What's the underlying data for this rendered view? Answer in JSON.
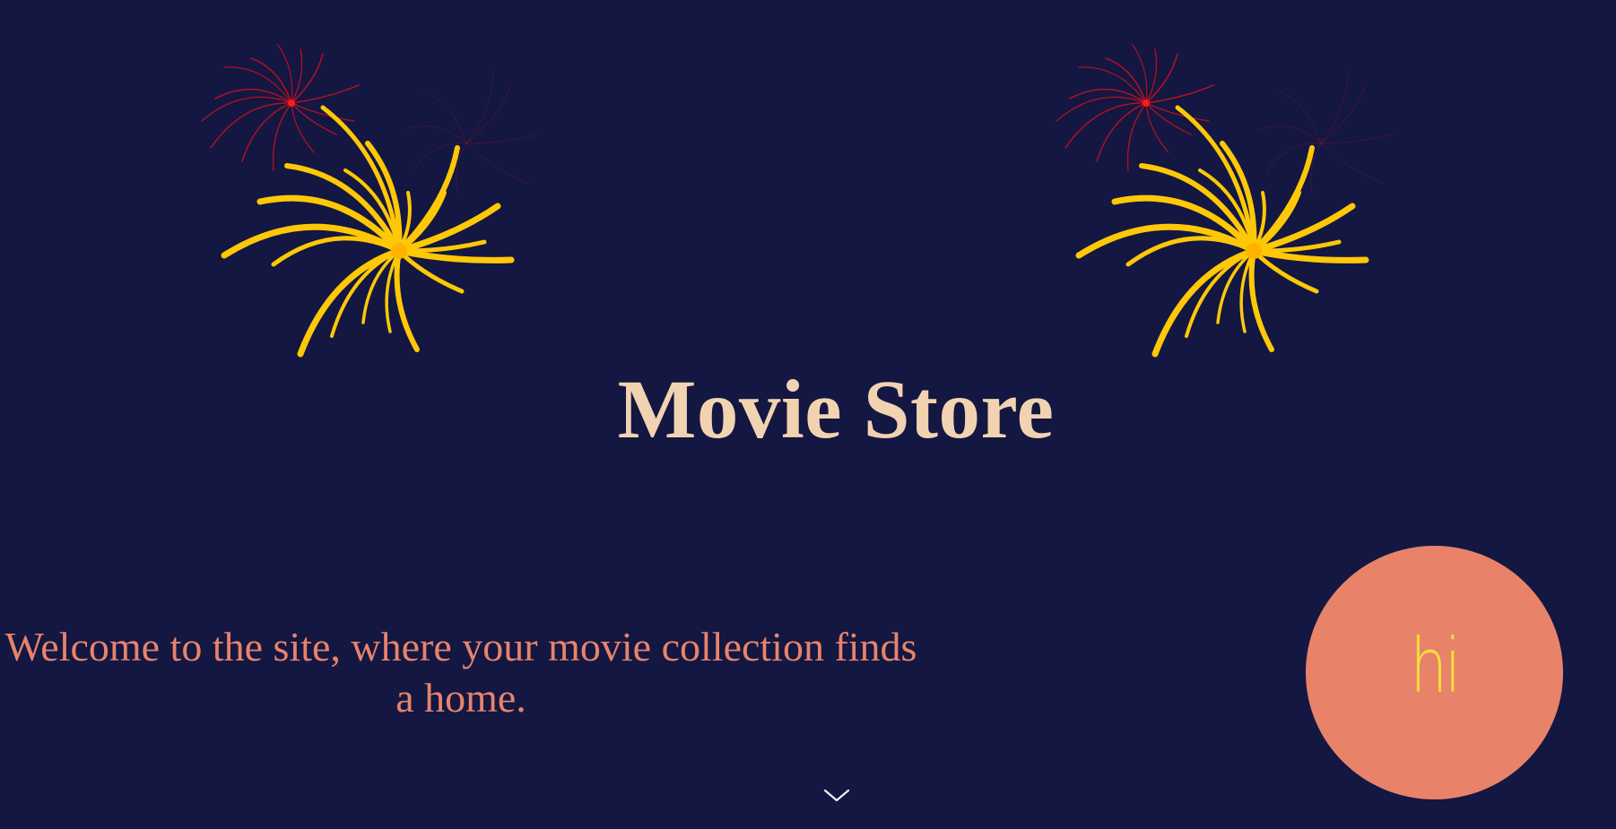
{
  "hero": {
    "title": "Movie Store",
    "welcome_text": "Welcome to the site, where your movie collection finds a home.",
    "greeting_button_label": "hi"
  },
  "icons": {
    "firework_left": "firework-icon",
    "firework_right": "firework-icon",
    "scroll_down": "chevron-down-icon"
  },
  "colors": {
    "background": "#131742",
    "title": "#f2d3b1",
    "welcome_text": "#e8836a",
    "greeting_button_bg": "#e8836a",
    "greeting_button_text": "#f7dd3b",
    "firework_gold": "#ffc807",
    "firework_red": "#c8101e"
  }
}
